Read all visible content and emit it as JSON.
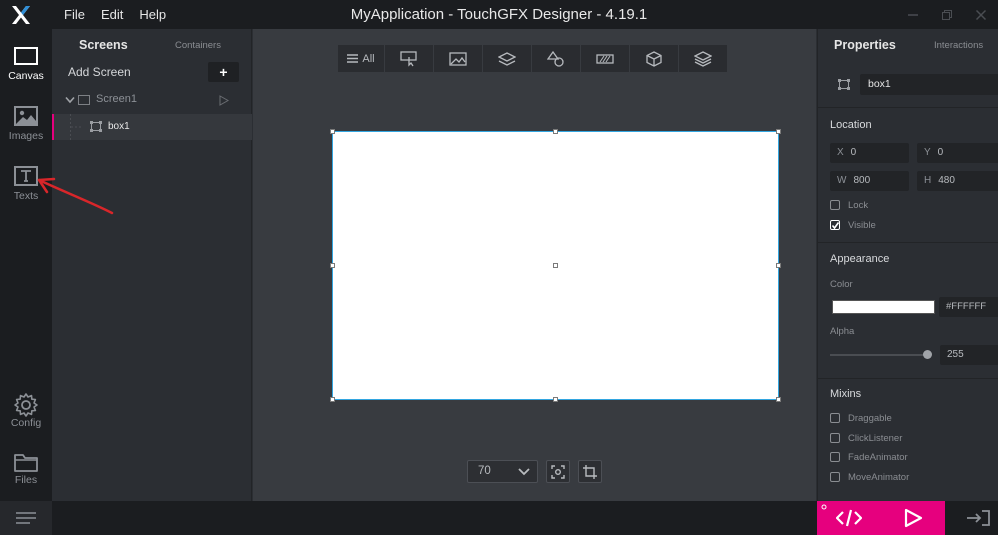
{
  "titlebar": {
    "menu": [
      "File",
      "Edit",
      "Help"
    ],
    "title": "MyApplication - TouchGFX Designer - 4.19.1"
  },
  "leftnav": {
    "items": [
      {
        "label": "Canvas",
        "icon": "canvas-icon"
      },
      {
        "label": "Images",
        "icon": "image-icon"
      },
      {
        "label": "Texts",
        "icon": "text-icon"
      },
      {
        "label": "Config",
        "icon": "gear-icon"
      },
      {
        "label": "Files",
        "icon": "folder-icon"
      }
    ]
  },
  "screens_panel": {
    "tab_screens": "Screens",
    "tab_containers": "Containers",
    "add_screen": "Add Screen",
    "add_button": "+",
    "tree": [
      {
        "label": "Screen1"
      },
      {
        "label": "box1"
      }
    ]
  },
  "toolbar": {
    "all_label": "All",
    "buttons": [
      "list-icon",
      "interaction-icon",
      "image-icon",
      "layers-icon",
      "shapes-icon",
      "progress-icon",
      "3d-cube-icon",
      "stack-icon"
    ]
  },
  "zoom": {
    "value": "70"
  },
  "properties": {
    "tab_properties": "Properties",
    "tab_interactions": "Interactions",
    "name": "box1",
    "location": {
      "title": "Location",
      "x_label": "X",
      "x": "0",
      "y_label": "Y",
      "y": "0",
      "w_label": "W",
      "w": "800",
      "h_label": "H",
      "h": "480"
    },
    "lock_label": "Lock",
    "visible_label": "Visible",
    "appearance": {
      "title": "Appearance",
      "color_label": "Color",
      "color_value": "#FFFFFF",
      "alpha_label": "Alpha",
      "alpha_value": "255"
    },
    "mixins": {
      "title": "Mixins",
      "items": [
        "Draggable",
        "ClickListener",
        "FadeAnimator",
        "MoveAnimator"
      ]
    }
  },
  "colors": {
    "accent": "#e6007e",
    "selection": "#33a6e0",
    "annotation_arrow": "#d9262a"
  }
}
